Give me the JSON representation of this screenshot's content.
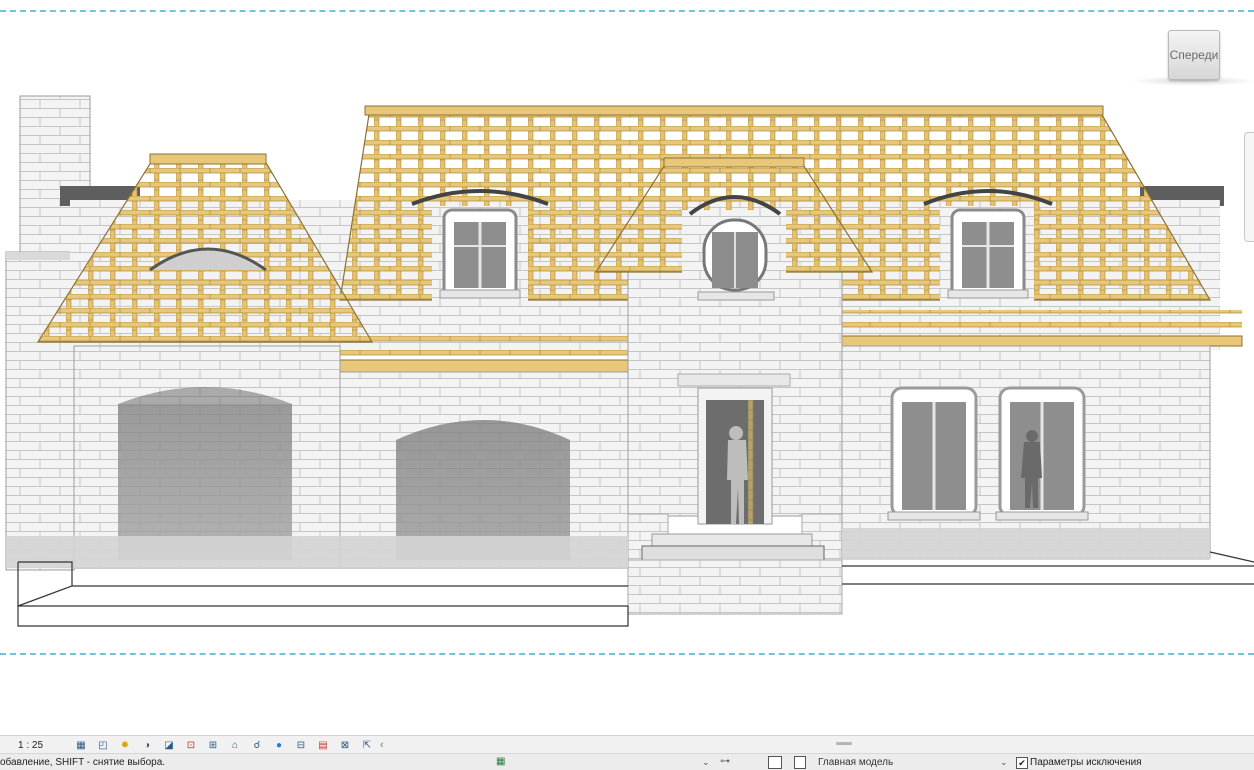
{
  "viewport": {
    "view_cube_label": "Спереди"
  },
  "view_control_bar": {
    "scale": "1 : 25",
    "tools": [
      {
        "name": "detail-level-icon",
        "glyph": "▦"
      },
      {
        "name": "visual-style-icon",
        "glyph": "◰"
      },
      {
        "name": "sun-path-icon",
        "glyph": "✹"
      },
      {
        "name": "shadows-icon",
        "glyph": "◑"
      },
      {
        "name": "render-icon",
        "glyph": "◪"
      },
      {
        "name": "crop-view-icon",
        "glyph": "⊡"
      },
      {
        "name": "crop-region-icon",
        "glyph": "⊞"
      },
      {
        "name": "unlocked-3d-icon",
        "glyph": "⌂"
      },
      {
        "name": "temporary-hide-icon",
        "glyph": "☌"
      },
      {
        "name": "reveal-hidden-icon",
        "glyph": "●"
      },
      {
        "name": "worksharing-display-icon",
        "glyph": "⊟"
      },
      {
        "name": "temporary-properties-icon",
        "glyph": "▤"
      },
      {
        "name": "analytical-model-icon",
        "glyph": "⊠"
      },
      {
        "name": "highlight-displacement-icon",
        "glyph": "⇱"
      }
    ],
    "collapse_glyph": "‹"
  },
  "status_bar": {
    "message": "обавление, SHIFT - снятие выбора.",
    "model_select": "Главная модель",
    "exclude_options_label": "Параметры исключения",
    "exclude_options_checked": "✔"
  },
  "colors": {
    "wood": "#e8c77a",
    "wood_dark": "#a8883c",
    "crop_line": "#76c1d9",
    "brick_light": "#f2f2f2",
    "brick_shade": "#9a9a9a"
  }
}
